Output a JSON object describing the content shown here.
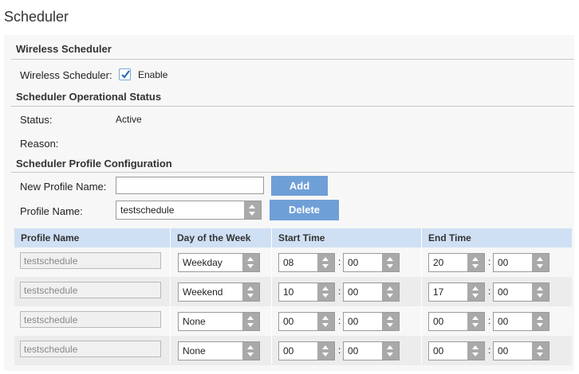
{
  "page": {
    "title": "Scheduler"
  },
  "wireless_scheduler": {
    "section_title": "Wireless Scheduler",
    "label": "Wireless Scheduler:",
    "enable_label": "Enable",
    "enabled": true
  },
  "operational_status": {
    "section_title": "Scheduler Operational Status",
    "status_label": "Status:",
    "status_value": "Active",
    "reason_label": "Reason:",
    "reason_value": ""
  },
  "profile_config": {
    "section_title": "Scheduler Profile Configuration",
    "new_profile_label": "New Profile Name:",
    "new_profile_value": "",
    "add_button": "Add",
    "profile_name_label": "Profile Name:",
    "profile_name_value": "testschedule",
    "delete_button": "Delete"
  },
  "table": {
    "headers": [
      "Profile Name",
      "Day of the Week",
      "Start Time",
      "End Time"
    ],
    "rows": [
      {
        "profile": "testschedule",
        "day": "Weekday",
        "start_h": "08",
        "start_m": "00",
        "end_h": "20",
        "end_m": "00"
      },
      {
        "profile": "testschedule",
        "day": "Weekend",
        "start_h": "10",
        "start_m": "00",
        "end_h": "17",
        "end_m": "00"
      },
      {
        "profile": "testschedule",
        "day": "None",
        "start_h": "00",
        "start_m": "00",
        "end_h": "00",
        "end_m": "00"
      },
      {
        "profile": "testschedule",
        "day": "None",
        "start_h": "00",
        "start_m": "00",
        "end_h": "00",
        "end_m": "00"
      }
    ],
    "time_separator": ":"
  },
  "colors": {
    "button": "#6f9fd7",
    "table_header": "#cfe0f4",
    "checkbox_check": "#2a6ebb"
  }
}
